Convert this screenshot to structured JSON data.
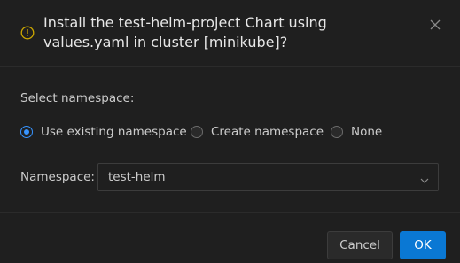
{
  "dialog": {
    "title": "Install the test-helm-project Chart using values.yaml in cluster [minikube]?",
    "close_icon": "close-icon",
    "warning_icon": "warning-icon"
  },
  "namespace_section": {
    "label": "Select namespace:",
    "options": [
      {
        "label": "Use existing namespace",
        "checked": true
      },
      {
        "label": "Create namespace",
        "checked": false
      },
      {
        "label": "None",
        "checked": false
      }
    ]
  },
  "namespace_field": {
    "label": "Namespace:",
    "value": "test-helm"
  },
  "buttons": {
    "cancel": "Cancel",
    "ok": "OK"
  },
  "colors": {
    "background": "#1f1f1f",
    "accent": "#0a78d4",
    "radio_accent": "#3794ff",
    "warning": "#cca700"
  }
}
